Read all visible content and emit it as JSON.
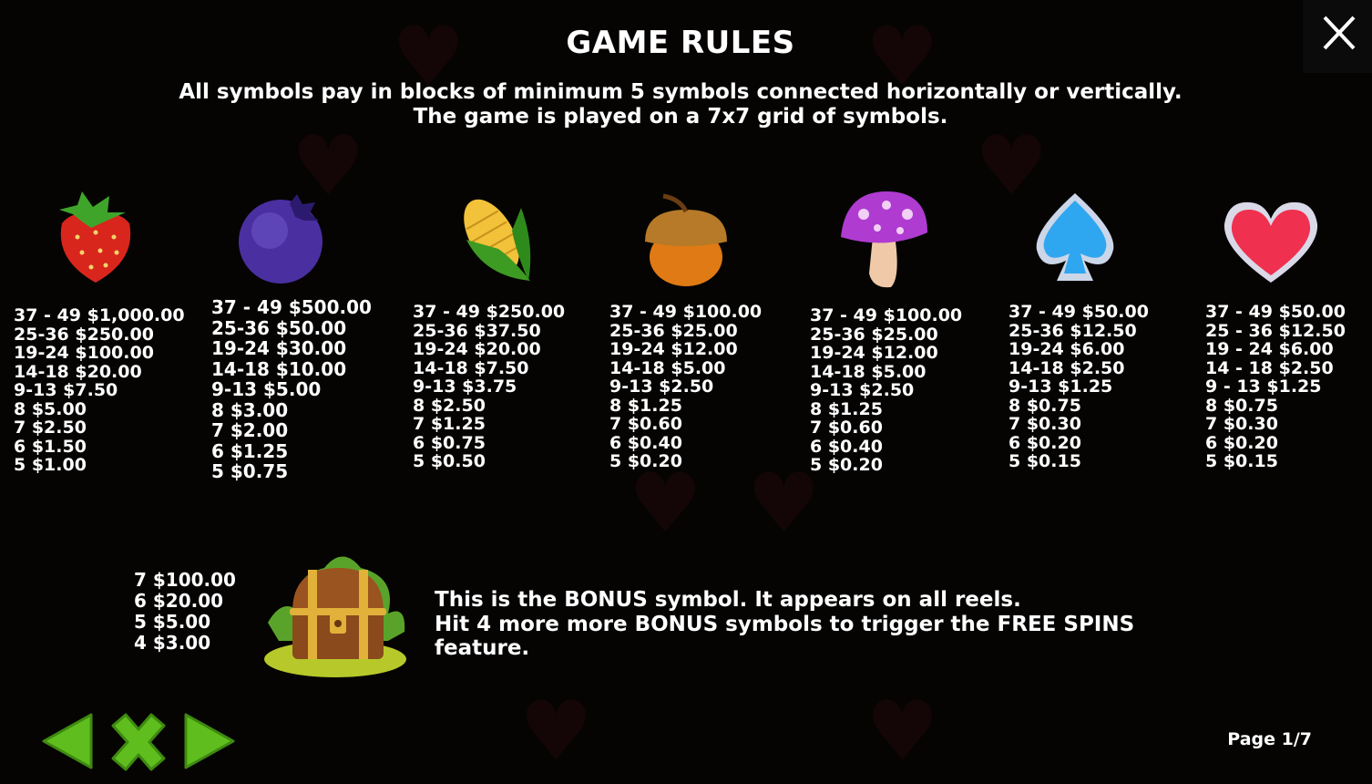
{
  "title": "GAME RULES",
  "subtitle": "All symbols pay in blocks of minimum 5 symbols connected horizontally or vertically.\nThe game is played on a 7x7 grid of symbols.",
  "symbols": [
    {
      "icon": "strawberry-icon",
      "pays": [
        "37 - 49  $1,000.00",
        "25-36  $250.00",
        "19-24  $100.00",
        "14-18  $20.00",
        "9-13  $7.50",
        "8  $5.00",
        "7  $2.50",
        "6  $1.50",
        "5  $1.00"
      ]
    },
    {
      "icon": "blueberry-icon",
      "pays": [
        "37 - 49  $500.00",
        "25-36  $50.00",
        "19-24  $30.00",
        "14-18  $10.00",
        "9-13  $5.00",
        "8  $3.00",
        "7  $2.00",
        "6  $1.25",
        "5  $0.75"
      ]
    },
    {
      "icon": "corn-icon",
      "pays": [
        "37 - 49  $250.00",
        "25-36  $37.50",
        "19-24  $20.00",
        "14-18  $7.50",
        "9-13  $3.75",
        "8  $2.50",
        "7  $1.25",
        "6  $0.75",
        "5  $0.50"
      ]
    },
    {
      "icon": "acorn-icon",
      "pays": [
        "37 - 49  $100.00",
        "25-36  $25.00",
        "19-24  $12.00",
        "14-18  $5.00",
        "9-13  $2.50",
        "8  $1.25",
        "7  $0.60",
        "6  $0.40",
        "5  $0.20"
      ]
    },
    {
      "icon": "mushroom-icon",
      "pays": [
        "37 - 49  $100.00",
        "25-36  $25.00",
        "19-24  $12.00",
        "14-18  $5.00",
        "9-13  $2.50",
        "8  $1.25",
        "7  $0.60",
        "6  $0.40",
        "5  $0.20"
      ]
    },
    {
      "icon": "spade-icon",
      "pays": [
        "37 - 49  $50.00",
        "25-36  $12.50",
        "19-24  $6.00",
        "14-18  $2.50",
        "9-13  $1.25",
        "8  $0.75",
        "7  $0.30",
        "6  $0.20",
        "5  $0.15"
      ]
    },
    {
      "icon": "heart-icon",
      "pays": [
        "37 - 49  $50.00",
        "25 - 36  $12.50",
        "19 - 24  $6.00",
        "14 - 18  $2.50",
        "9 - 13  $1.25",
        "8  $0.75",
        "7  $0.30",
        "6  $0.20",
        "5  $0.15"
      ]
    }
  ],
  "bonus": {
    "icon": "treasure-chest-icon",
    "pays": [
      "7  $100.00",
      "6  $20.00",
      "5  $5.00",
      "4  $3.00"
    ],
    "text": [
      "This is the BONUS symbol. It appears on all reels.",
      "Hit 4 more more BONUS symbols to trigger the FREE SPINS",
      "feature."
    ]
  },
  "nav": {
    "prev_icon": "arrow-left-icon",
    "close_icon": "close-x-icon",
    "next_icon": "arrow-right-icon"
  },
  "page_label": "Page 1/7",
  "colors": {
    "accent_green": "#5fbe1e",
    "background": "#050403",
    "text": "#ffffff"
  }
}
